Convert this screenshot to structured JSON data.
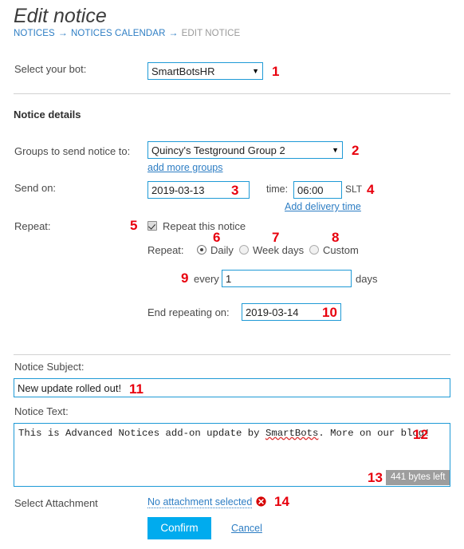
{
  "page": {
    "title": "Edit notice"
  },
  "breadcrumb": {
    "items": [
      {
        "label": "NOTICES",
        "current": false
      },
      {
        "label": "NOTICES CALENDAR",
        "current": false
      },
      {
        "label": "EDIT NOTICE",
        "current": true
      }
    ],
    "separator": "→"
  },
  "bot": {
    "label": "Select your bot:",
    "selected": "SmartBotsHR",
    "caret": "▼",
    "marker": "1"
  },
  "section": {
    "heading": "Notice details"
  },
  "groups": {
    "label": "Groups to send notice to:",
    "selected": "Quincy's Testground Group 2",
    "caret": "▼",
    "marker": "2",
    "add_more_link": "add more groups"
  },
  "send_on": {
    "label": "Send on:",
    "date_value": "2019-03-13",
    "date_marker": "3",
    "time_label": "time:",
    "time_value": "06:00",
    "timezone": "SLT",
    "time_marker": "4",
    "add_delivery_link": "Add delivery time"
  },
  "repeat": {
    "label": "Repeat:",
    "checkbox_label": "Repeat this notice",
    "checkbox_checked": true,
    "checkbox_marker": "5",
    "sub_label": "Repeat:",
    "options": [
      {
        "label": "Daily",
        "selected": true,
        "marker": "6"
      },
      {
        "label": "Week days",
        "selected": false,
        "marker": "7"
      },
      {
        "label": "Custom",
        "selected": false,
        "marker": "8"
      }
    ],
    "every_marker": "9",
    "every_label": "every",
    "every_value": "1",
    "days_label": "days",
    "end_label": "End repeating on:",
    "end_value": "2019-03-14",
    "end_marker": "10"
  },
  "subject": {
    "label": "Notice Subject:",
    "value": "New update rolled out!",
    "marker": "11"
  },
  "notice_text": {
    "label": "Notice Text:",
    "text_before": "This is Advanced Notices add-on update by ",
    "text_misspelled": "SmartBots",
    "text_after": ". More on our blog!",
    "marker": "12",
    "bytes_left": "441 bytes left",
    "bytes_marker": "13"
  },
  "attachment": {
    "label": "Select Attachment",
    "link": "No attachment selected",
    "marker": "14",
    "clear_icon": "error-circle-x-icon"
  },
  "actions": {
    "confirm_label": "Confirm",
    "cancel_label": "Cancel"
  },
  "colors": {
    "accent_blue": "#00ABEE",
    "link_blue": "#2e7ec4",
    "input_border": "#1f9ad6",
    "marker_red": "#e8000d",
    "badge_gray": "#9d9d9d"
  }
}
